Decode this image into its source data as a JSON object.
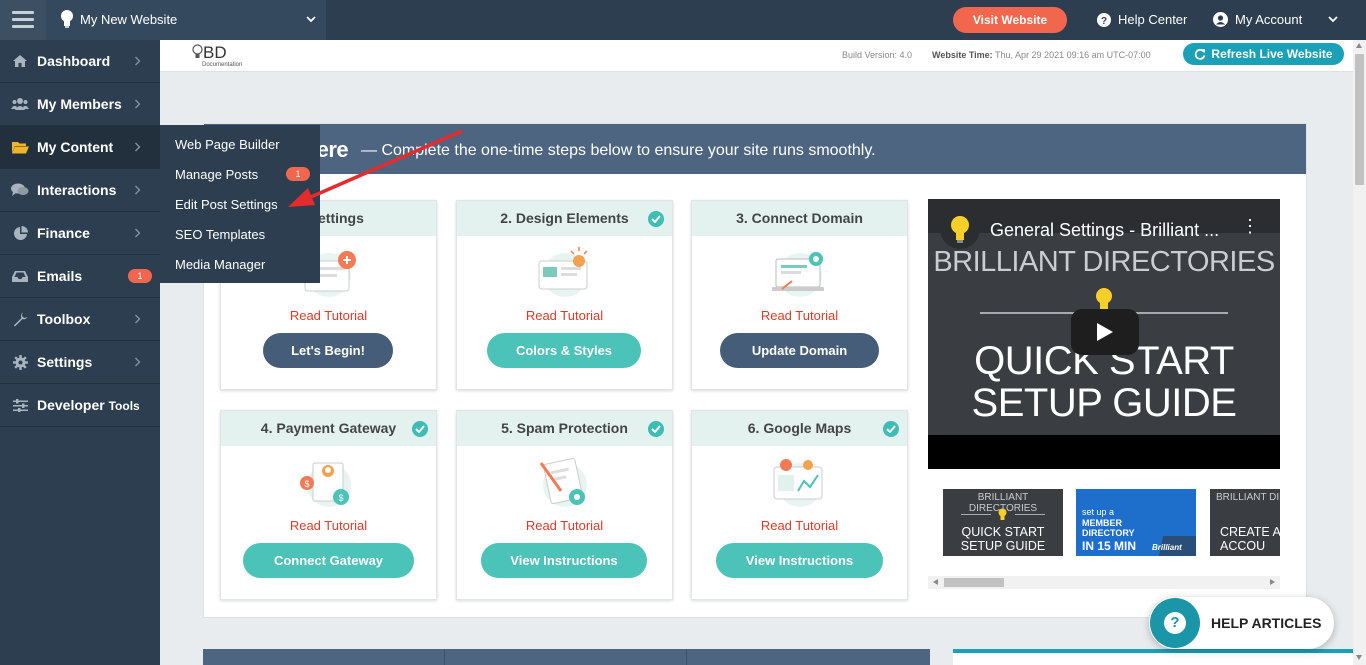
{
  "topbar": {
    "site_name": "My New Website",
    "visit_button": "Visit Website",
    "help_center": "Help Center",
    "my_account": "My Account"
  },
  "sidebar": {
    "items": [
      {
        "label": "Dashboard",
        "icon": "home-icon"
      },
      {
        "label": "My Members",
        "icon": "users-icon"
      },
      {
        "label": "My Content",
        "icon": "folder-open-icon",
        "active": true
      },
      {
        "label": "Interactions",
        "icon": "comments-icon"
      },
      {
        "label": "Finance",
        "icon": "pie-chart-icon"
      },
      {
        "label": "Emails",
        "icon": "inbox-icon",
        "badge": "1"
      },
      {
        "label": "Toolbox",
        "icon": "wrench-icon"
      },
      {
        "label": "Settings",
        "icon": "gear-icon"
      },
      {
        "label": "Developer",
        "label_small": "Tools",
        "icon": "sliders-icon"
      }
    ]
  },
  "flyout": {
    "items": [
      {
        "label": "Web Page Builder"
      },
      {
        "label": "Manage Posts",
        "badge": "1"
      },
      {
        "label": "Edit Post Settings"
      },
      {
        "label": "SEO Templates"
      },
      {
        "label": "Media Manager"
      }
    ]
  },
  "subheader": {
    "logo_text": "BD",
    "logo_sub": "Documentation",
    "build_version": "Build Version: 4.0",
    "website_time_label": "Website Time:",
    "website_time_value": "Thu, Apr 29 2021 09:16 am UTC-07:00",
    "refresh_button": "Refresh Live Website"
  },
  "panel": {
    "title_partial": "lere",
    "subtitle": "— Complete the one-time steps below to ensure your site runs smoothly.",
    "cards": [
      {
        "title": "al Settings",
        "read": "Read Tutorial",
        "button": "Let's Begin!",
        "button_style": "dark",
        "checked": false
      },
      {
        "title": "2. Design Elements",
        "read": "Read Tutorial",
        "button": "Colors & Styles",
        "button_style": "teal",
        "checked": true
      },
      {
        "title": "3. Connect Domain",
        "read": "Read Tutorial",
        "button": "Update Domain",
        "button_style": "dark",
        "checked": false
      },
      {
        "title": "4. Payment Gateway",
        "read": "Read Tutorial",
        "button": "Connect Gateway",
        "button_style": "teal",
        "checked": true
      },
      {
        "title": "5. Spam Protection",
        "read": "Read Tutorial",
        "button": "View Instructions",
        "button_style": "teal",
        "checked": true
      },
      {
        "title": "6. Google Maps",
        "read": "Read Tutorial",
        "button": "View Instructions",
        "button_style": "teal",
        "checked": true
      }
    ]
  },
  "video": {
    "title": "General Settings - Brilliant ...",
    "brand": "BRILLIANT DIRECTORIES",
    "line1": "QUICK START",
    "line2": "SETUP GUIDE"
  },
  "thumbnails": {
    "t1_brand": "BRILLIANT DIRECTORIES",
    "t1_line1": "QUICK START",
    "t1_line2": "SETUP GUIDE",
    "t2_line1": "set up a",
    "t2_line2": "MEMBER",
    "t2_line3": "DIRECTORY",
    "t2_line4": "IN 15 MIN",
    "t2_logo": "Brilliant",
    "t3_brand": "BRILLIANT DIRE",
    "t3_line1": "CREATE A",
    "t3_line2": "ACCOU"
  },
  "help_articles": {
    "label": "HELP ARTICLES"
  },
  "colors": {
    "sidebar": "#2c3e50",
    "accent_orange": "#f2664e",
    "teal": "#4cc3b8",
    "refresh_blue": "#1aa1b8",
    "panel_header": "#4d6580",
    "read_tutorial_red": "#d93c2b"
  }
}
